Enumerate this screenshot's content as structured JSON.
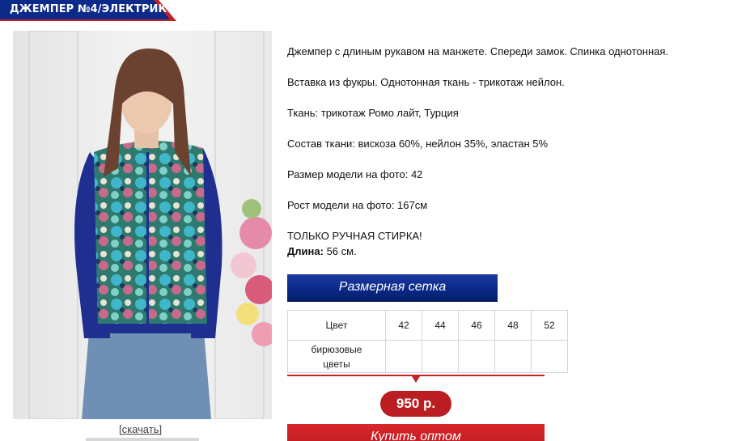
{
  "header": {
    "title": "ДЖЕМПЕР №4/ЭЛЕКТРИК"
  },
  "product": {
    "download_link": "[скачать]",
    "description": {
      "line1": "Джемпер с длиным рукавом на манжете. Спереди замок. Спинка однотонная.",
      "line2": "Вставка из фукры. Однотонная ткань - трикотаж нейлон.",
      "line3": "Ткань: трикотаж Ромо лайт, Турция",
      "line4": "Состав ткани: вискоза 60%, нейлон 35%, эластан 5%",
      "line5": "Размер модели на фото: 42",
      "line6": "Рост модели на фото: 167см",
      "line7": "ТОЛЬКО РУЧНАЯ СТИРКА!",
      "length_label": "Длина:",
      "length_value": "56 см."
    }
  },
  "size_grid": {
    "button_label": "Размерная сетка",
    "header_label": "Цвет",
    "sizes": [
      "42",
      "44",
      "46",
      "48",
      "52"
    ],
    "color_label_1": "бирюзовые",
    "color_label_2": "цветы"
  },
  "purchase": {
    "price": "950 р.",
    "buy_button": "Купить оптом"
  },
  "colors": {
    "title_blue": "#0b2a8a",
    "title_red": "#c42026",
    "price_red": "#bb1e22"
  }
}
